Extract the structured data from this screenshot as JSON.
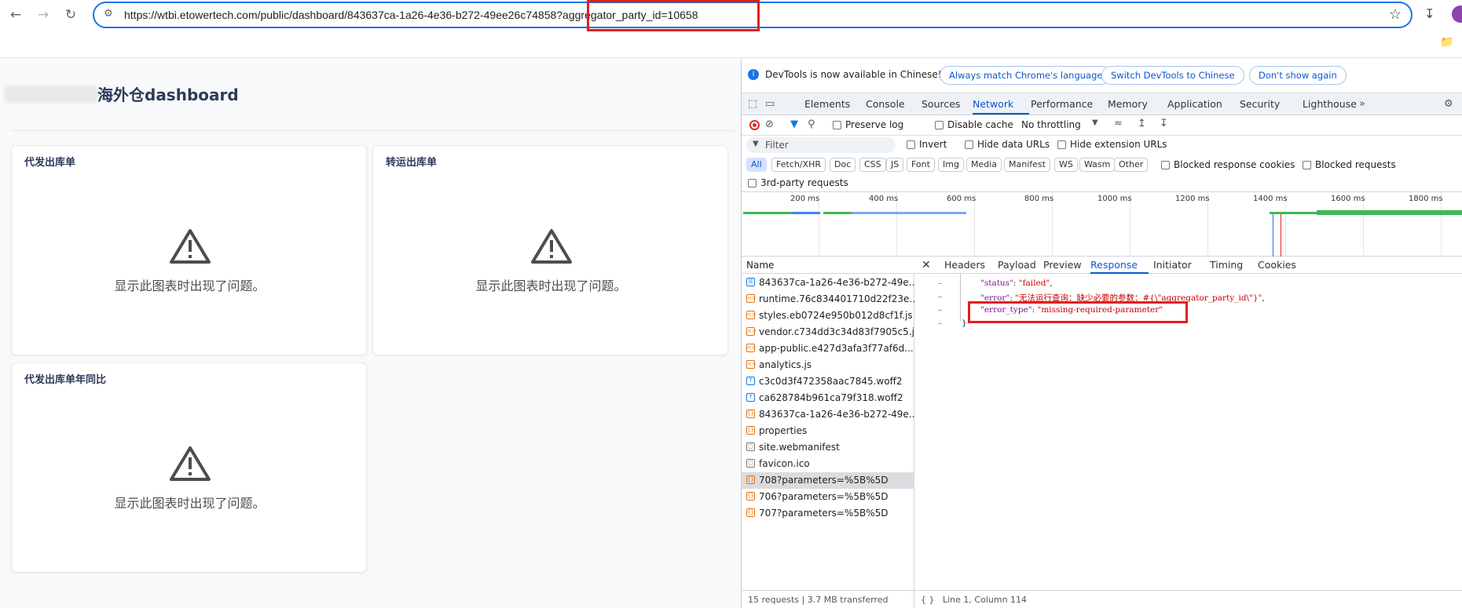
{
  "browser": {
    "url": "https://wtbi.etowertech.com/public/dashboard/843637ca-1a26-4e36-b272-49ee26c74858?aggregator_party_id=10658"
  },
  "dashboard": {
    "title": "海外仓dashboard",
    "error_message": "显示此图表时出现了问题。",
    "cards": [
      {
        "title": "代发出库单"
      },
      {
        "title": "转运出库单"
      },
      {
        "title": "代发出库单年同比"
      }
    ]
  },
  "devtools": {
    "infobar": {
      "text": "DevTools is now available in Chinese!",
      "btn_match": "Always match Chrome's language",
      "btn_switch": "Switch DevTools to Chinese",
      "btn_dismiss": "Don't show again"
    },
    "tabs": [
      "Elements",
      "Console",
      "Sources",
      "Network",
      "Performance",
      "Memory",
      "Application",
      "Security",
      "Lighthouse"
    ],
    "network_bar": {
      "preserve_log": "Preserve log",
      "disable_cache": "Disable cache",
      "throttling": "No throttling"
    },
    "filter": {
      "placeholder": "Filter",
      "invert": "Invert",
      "hide_data_urls": "Hide data URLs",
      "hide_extension_urls": "Hide extension URLs"
    },
    "type_chips": [
      "All",
      "Fetch/XHR",
      "Doc",
      "CSS",
      "JS",
      "Font",
      "Img",
      "Media",
      "Manifest",
      "WS",
      "Wasm",
      "Other"
    ],
    "blocked_response_cookies": "Blocked response cookies",
    "blocked_requests": "Blocked requests",
    "third_party": "3rd-party requests",
    "timeline_labels": [
      "200 ms",
      "400 ms",
      "600 ms",
      "800 ms",
      "1000 ms",
      "1200 ms",
      "1400 ms",
      "1600 ms",
      "1800 ms"
    ],
    "requests_header": "Name",
    "requests": [
      {
        "name": "843637ca-1a26-4e36-b272-49e...",
        "type": "doc"
      },
      {
        "name": "runtime.76c834401710d22f23e...",
        "type": "js"
      },
      {
        "name": "styles.eb0724e950b012d8cf1f.js",
        "type": "js"
      },
      {
        "name": "vendor.c734dd3c34d83f7905c5.js",
        "type": "js"
      },
      {
        "name": "app-public.e427d3afa3f77af6d...",
        "type": "js"
      },
      {
        "name": "analytics.js",
        "type": "js"
      },
      {
        "name": "c3c0d3f472358aac7845.woff2",
        "type": "font"
      },
      {
        "name": "ca628784b961ca79f318.woff2",
        "type": "font"
      },
      {
        "name": "843637ca-1a26-4e36-b272-49e...",
        "type": "fetch"
      },
      {
        "name": "properties",
        "type": "fetch"
      },
      {
        "name": "site.webmanifest",
        "type": "plain"
      },
      {
        "name": "favicon.ico",
        "type": "plain"
      },
      {
        "name": "708?parameters=%5B%5D",
        "type": "fetch"
      },
      {
        "name": "706?parameters=%5B%5D",
        "type": "fetch"
      },
      {
        "name": "707?parameters=%5B%5D",
        "type": "fetch"
      }
    ],
    "selected_request_index": 12,
    "requests_footer": "15 requests | 3.7 MB transferred",
    "detail_tabs": [
      "Headers",
      "Payload",
      "Preview",
      "Response",
      "Initiator",
      "Timing",
      "Cookies"
    ],
    "response": {
      "status_key": "\"status\"",
      "status_val": "\"failed\"",
      "error_key": "\"error\"",
      "error_val": "\"无法运行查询：缺少必要的参数：#{\\\"aggregator_party_id\\\"}\"",
      "error_type_key": "\"error_type\"",
      "error_type_val": "\"missing-required-parameter\"",
      "close_brace": "}"
    },
    "detail_footer": "Line 1, Column 114"
  }
}
